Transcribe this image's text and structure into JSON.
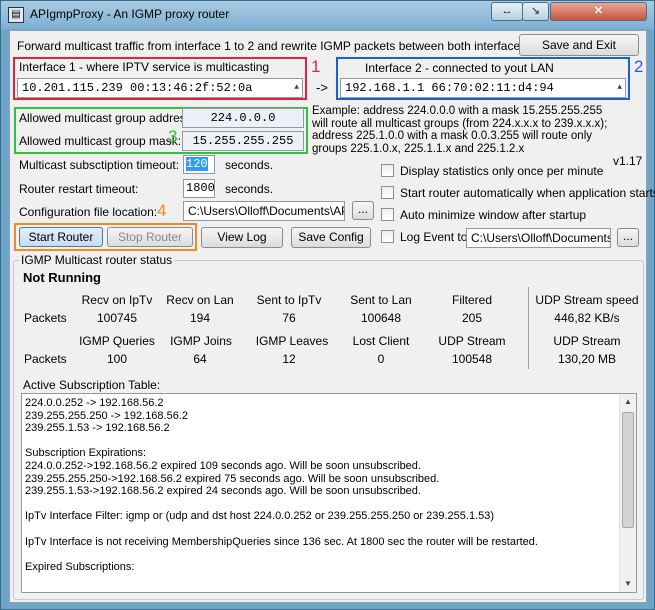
{
  "window": {
    "title": "APIgmpProxy - An IGMP proxy router",
    "titlebar_btn1": "↔",
    "titlebar_btn2": "↘",
    "close_label": "✕",
    "app_icon": "network-icon"
  },
  "header": {
    "description": "Forward multicast traffic from interface 1 to 2 and rewrite IGMP packets between both interfaces",
    "save_exit": "Save and Exit"
  },
  "interface1": {
    "label": "Interface 1 - where IPTV service is multicasting",
    "value": "10.201.115.239   00:13:46:2f:52:0a"
  },
  "interface2": {
    "label": "Interface 2 - connected to yout LAN",
    "value": "192.168.1.1      66:70:02:11:d4:94"
  },
  "arrow": "->",
  "annotations": {
    "a1": "1",
    "a2": "2",
    "a3": "3",
    "a4": "4"
  },
  "group": {
    "address_label": "Allowed multicast group address:",
    "address_value": "224.0.0.0",
    "mask_label": "Allowed multicast group mask:",
    "mask_value": "15.255.255.255"
  },
  "example": {
    "line1": "Example: address 224.0.0.0 with a mask 15.255.255.255",
    "line2": "will route all multicast groups (from 224.x.x.x to 239.x.x.x);",
    "line3": "address 225.1.0.0 with a mask 0.0.3.255 will route only",
    "line4": "groups 225.1.0.x, 225.1.1.x and 225.1.2.x"
  },
  "version": "v1.17",
  "settings": {
    "sub_timeout_label": "Multicast subsctiption timeout:",
    "sub_timeout_value": "120",
    "seconds1": "seconds.",
    "restart_label": "Router restart timeout:",
    "restart_value": "1800",
    "seconds2": "seconds.",
    "config_label": "Configuration file location:",
    "config_value": "C:\\Users\\Olloff\\Documents\\APIg",
    "browse": "..."
  },
  "options": {
    "stats_once": "Display statistics only once per minute",
    "auto_start": "Start router automatically when application starts",
    "auto_min": "Auto minimize window after startup",
    "log_event": "Log Event to:",
    "log_path": "C:\\Users\\Olloff\\Documents\\A",
    "browse": "..."
  },
  "buttons": {
    "start": "Start Router",
    "stop": "Stop Router",
    "view_log": "View Log",
    "save_config": "Save Config"
  },
  "status": {
    "group_title": "IGMP Multicast router status",
    "state": "Not Running",
    "row1_headers": [
      "Recv on IpTv",
      "Recv on Lan",
      "Sent to IpTv",
      "Sent to Lan",
      "Filtered"
    ],
    "row1_label": "Packets",
    "row1_values": [
      "100745",
      "194",
      "76",
      "100648",
      "205"
    ],
    "row2_headers": [
      "IGMP Queries",
      "IGMP Joins",
      "IGMP Leaves",
      "Lost Client",
      "UDP Stream"
    ],
    "row2_label": "Packets",
    "row2_values": [
      "100",
      "64",
      "12",
      "0",
      "100548"
    ],
    "speed_header": "UDP Stream speed",
    "speed_value": "446,82 KB/s",
    "stream_header": "UDP Stream",
    "stream_value": "130,20 MB"
  },
  "subscriptions": {
    "title": "Active Subscription Table:",
    "lines": [
      "224.0.0.252 -> 192.168.56.2",
      "239.255.255.250 -> 192.168.56.2",
      "239.255.1.53 -> 192.168.56.2",
      "",
      "Subscription Expirations:",
      "224.0.0.252->192.168.56.2 expired 109 seconds ago. Will be soon unsubscribed.",
      "239.255.255.250->192.168.56.2 expired 75 seconds ago. Will be soon unsubscribed.",
      "239.255.1.53->192.168.56.2 expired 24 seconds ago. Will be soon unsubscribed.",
      "",
      "IpTv Interface Filter: igmp or (udp and dst host 224.0.0.252 or 239.255.255.250 or 239.255.1.53)",
      "",
      "IpTv Interface is not receiving MembershipQueries since 136 sec. At 1800 sec the router will be restarted.",
      "",
      "Expired Subscriptions:"
    ]
  }
}
